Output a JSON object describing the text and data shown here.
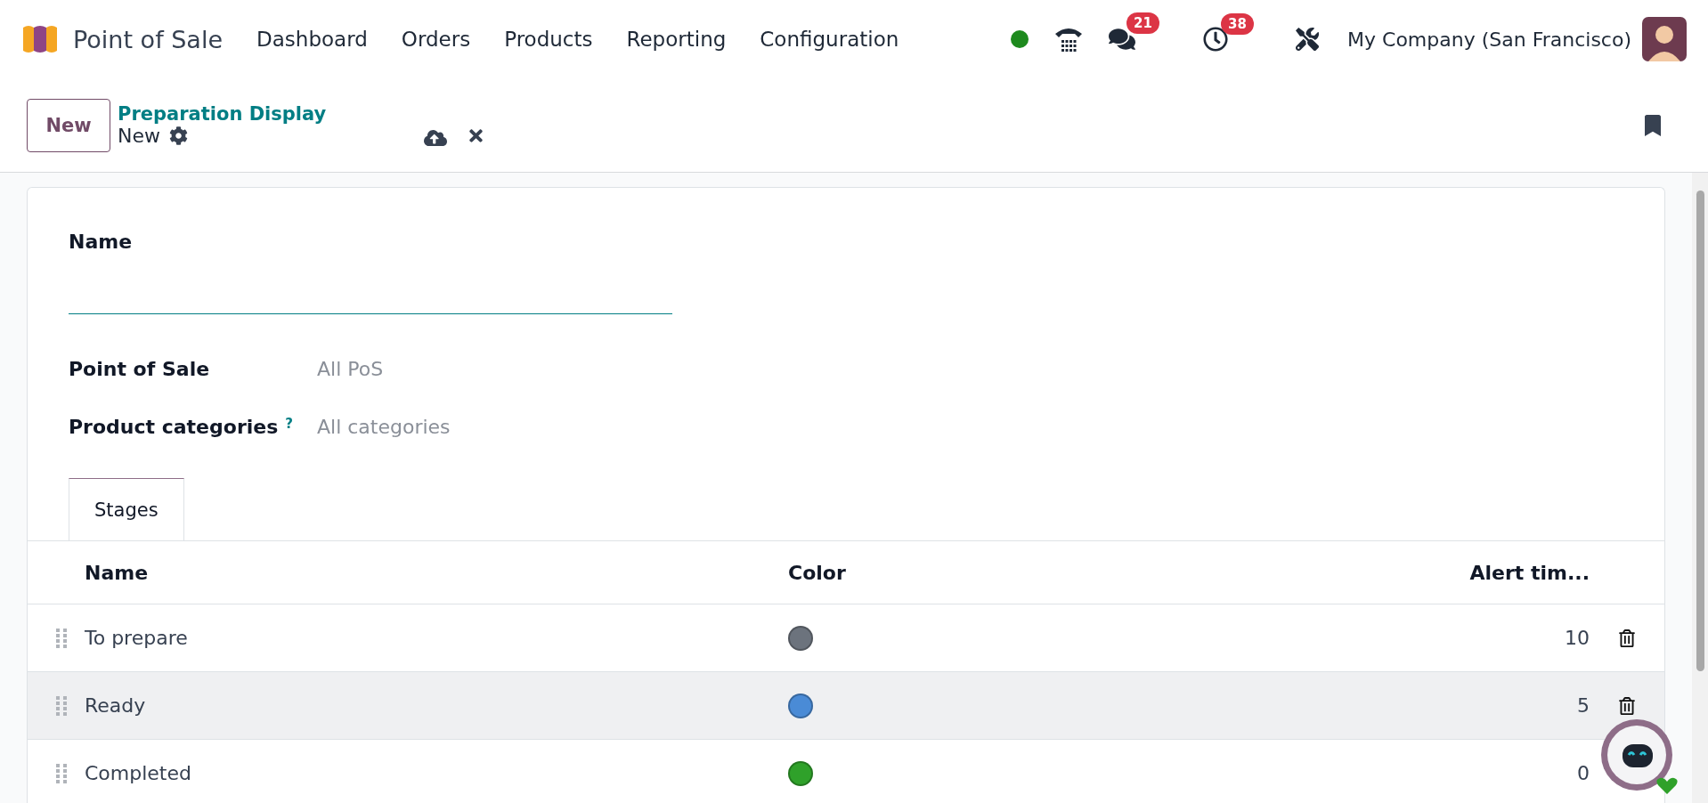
{
  "app": {
    "name": "Point of Sale"
  },
  "menu": [
    {
      "label": "Dashboard"
    },
    {
      "label": "Orders"
    },
    {
      "label": "Products"
    },
    {
      "label": "Reporting"
    },
    {
      "label": "Configuration"
    }
  ],
  "systray": {
    "chat_count": "21",
    "activity_count": "38",
    "company": "My Company (San Francisco)"
  },
  "control_panel": {
    "new_button": "New",
    "breadcrumb": "Preparation Display",
    "record": "New"
  },
  "form": {
    "name_label": "Name",
    "fields": [
      {
        "label": "Point of Sale",
        "placeholder": "All PoS"
      },
      {
        "label": "Product categories",
        "help": "?",
        "placeholder": "All categories"
      }
    ]
  },
  "tabs": [
    {
      "label": "Stages",
      "selected": true
    }
  ],
  "table": {
    "columns": [
      "Name",
      "Color",
      "Alert tim..."
    ],
    "rows": [
      {
        "name": "To prepare",
        "color": "#6c737d",
        "alert": "10",
        "hovered": false
      },
      {
        "name": "Ready",
        "color": "#4a8bd6",
        "alert": "5",
        "hovered": true
      },
      {
        "name": "Completed",
        "color": "#2fa12a",
        "alert": "0",
        "hovered": false
      }
    ]
  }
}
